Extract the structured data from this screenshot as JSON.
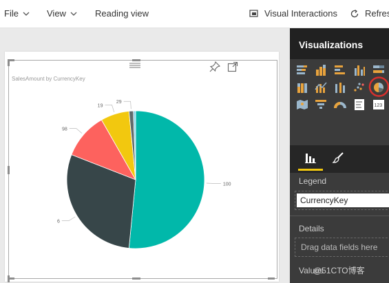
{
  "menu": {
    "file": "File",
    "view": "View",
    "reading_view": "Reading view",
    "visual_interactions": "Visual Interactions",
    "refresh": "Refresh"
  },
  "visual": {
    "pin_icon": "pin-icon",
    "focus_icon": "focus-mode-icon"
  },
  "viz_pane": {
    "title": "Visualizations",
    "legend_label": "Legend",
    "legend_field": "CurrencyKey",
    "details_label": "Details",
    "details_placeholder": "Drag data fields here",
    "values_label": "Values",
    "accent": "#f2c80f",
    "selected_ring": "#d9302d"
  },
  "watermark": "@51CTO博客",
  "chart_data": {
    "type": "pie",
    "title": "SalesAmount by CurrencyKey",
    "slices": [
      {
        "label": "100",
        "value": 100,
        "color": "#01b8aa"
      },
      {
        "label": "6",
        "value": 57,
        "color": "#374649"
      },
      {
        "label": "98",
        "value": 21,
        "color": "#fd625e"
      },
      {
        "label": "19",
        "value": 13,
        "color": "#f2c80f"
      },
      {
        "label": "29",
        "value": 2,
        "color": "#5f6b6d"
      },
      {
        "label": "",
        "value": 1,
        "color": "#8ad4eb"
      }
    ]
  }
}
